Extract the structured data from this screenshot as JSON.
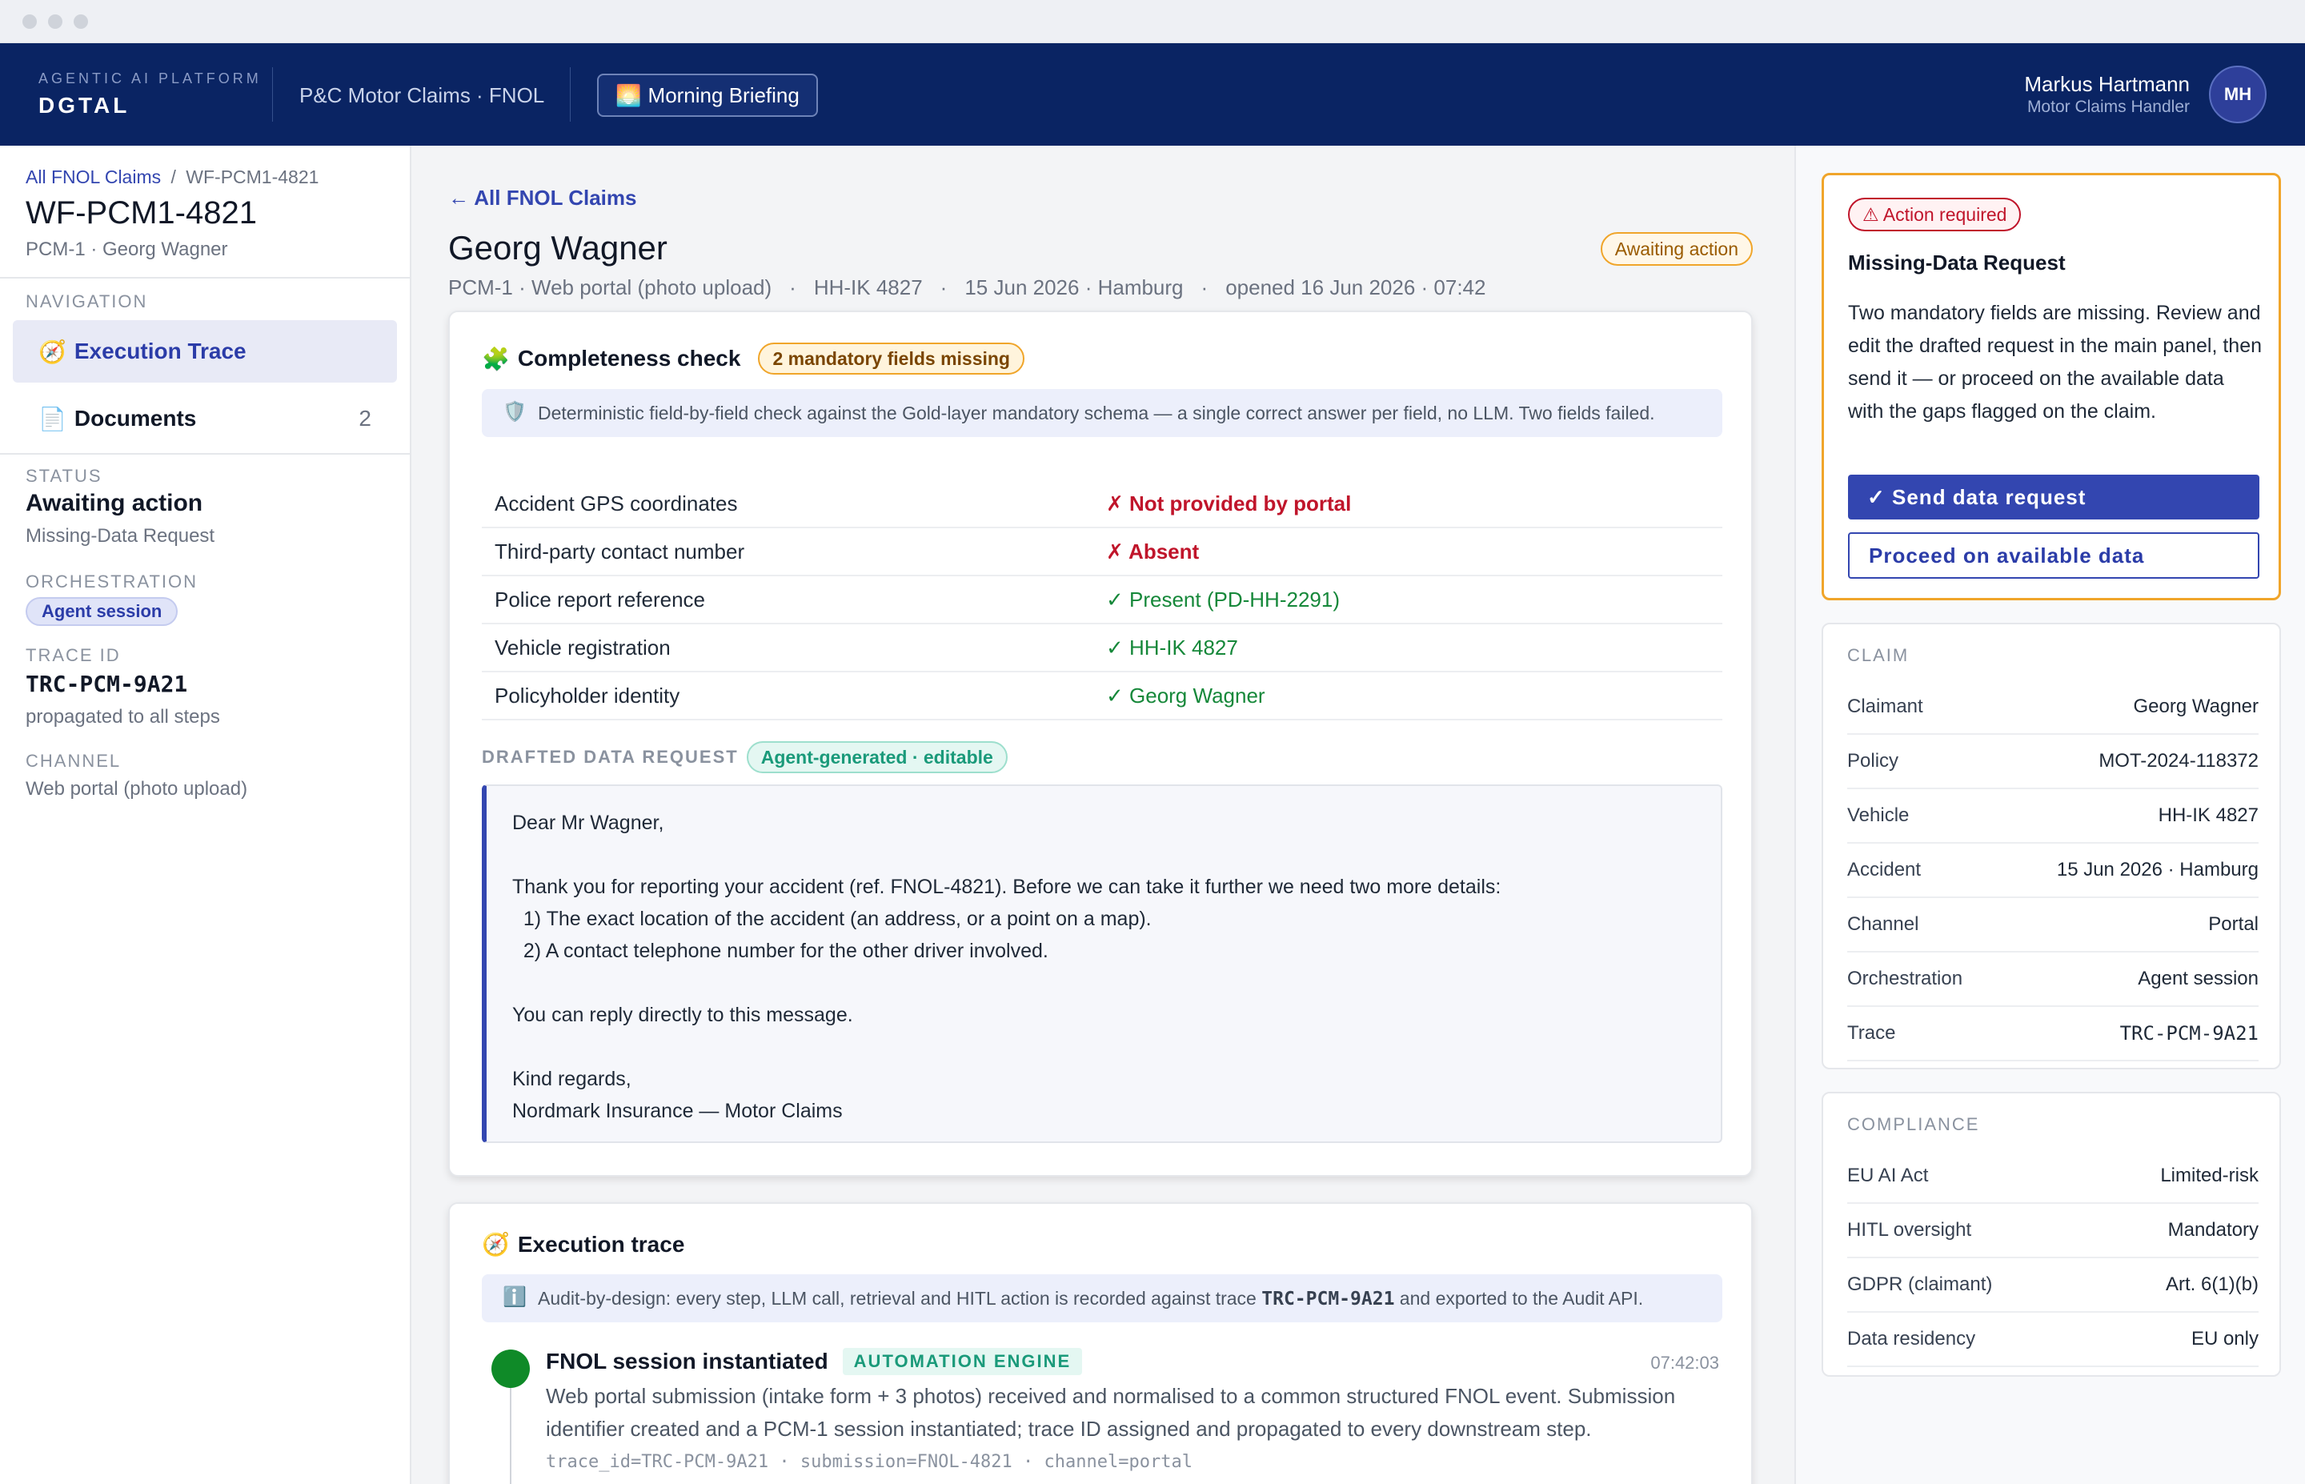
{
  "header": {
    "platform_label": "AGENTIC AI PLATFORM",
    "brand": "DGTAL",
    "product": "P&C Motor Claims · FNOL",
    "briefing_icon": "🌅",
    "briefing_label": "Morning Briefing",
    "user_name": "Markus Hartmann",
    "user_role": "Motor Claims Handler",
    "user_initials": "MH"
  },
  "sidebar": {
    "breadcrumb_root": "All FNOL Claims",
    "breadcrumb_sep": "/",
    "breadcrumb_current": "WF-PCM1-4821",
    "workflow_id": "WF-PCM1-4821",
    "workflow_sub": "PCM-1 · Georg Wagner",
    "nav_label": "NAVIGATION",
    "nav": [
      {
        "icon": "🧭",
        "label": "Execution Trace"
      },
      {
        "icon": "📄",
        "label": "Documents",
        "count": "2"
      }
    ],
    "status_label": "STATUS",
    "status_value": "Awaiting action",
    "status_sub": "Missing-Data Request",
    "orchestration_label": "ORCHESTRATION",
    "orchestration_value": "Agent session",
    "trace_label": "TRACE ID",
    "trace_value": "TRC-PCM-9A21",
    "trace_sub": "propagated to all steps",
    "channel_label": "CHANNEL",
    "channel_value": "Web portal (photo upload)"
  },
  "main": {
    "back_label": "← All FNOL Claims",
    "claimant": "Georg Wagner",
    "meta": [
      "PCM-1 · Web portal (photo upload)",
      "HH-IK 4827",
      "15 Jun 2026 · Hamburg",
      "opened 16 Jun 2026 · 07:42"
    ],
    "meta_sep": "·",
    "status_pill": "Awaiting action",
    "completeness": {
      "icon": "🧩",
      "title": "Completeness check",
      "badge": "2 mandatory fields missing",
      "info_icon": "🛡️",
      "info": "Deterministic field-by-field check against the Gold-layer mandatory schema — a single correct answer per field, no LLM. Two fields failed.",
      "fields": [
        {
          "label": "Accident GPS coordinates",
          "value": "✗ Not provided by portal",
          "status": "bad"
        },
        {
          "label": "Third-party contact number",
          "value": "✗ Absent",
          "status": "bad"
        },
        {
          "label": "Police report reference",
          "value": "✓ Present (PD-HH-2291)",
          "status": "ok"
        },
        {
          "label": "Vehicle registration",
          "value": "✓ HH-IK 4827",
          "status": "ok"
        },
        {
          "label": "Policyholder identity",
          "value": "✓ Georg Wagner",
          "status": "ok"
        }
      ],
      "drafted_label": "DRAFTED DATA REQUEST",
      "drafted_badge": "Agent-generated · editable",
      "letter": "Dear Mr Wagner,\n\nThank you for reporting your accident (ref. FNOL-4821). Before we can take it further we need two more details:\n  1) The exact location of the accident (an address, or a point on a map).\n  2) A contact telephone number for the other driver involved.\n\nYou can reply directly to this message.\n\nKind regards,\nNordmark Insurance — Motor Claims"
    },
    "trace": {
      "icon": "🧭",
      "title": "Execution trace",
      "info_icon": "ℹ️",
      "info_prefix": "Audit-by-design: every step, LLM call, retrieval and HITL action is recorded against trace ",
      "info_trace": "TRC-PCM-9A21",
      "info_suffix": " and exported to the Audit API.",
      "step": {
        "title": "FNOL session instantiated",
        "badge": "AUTOMATION ENGINE",
        "time": "07:42:03",
        "desc": "Web portal submission (intake form + 3 photos) received and normalised to a common structured FNOL event. Submission identifier created and a PCM-1 session instantiated; trace ID assigned and propagated to every downstream step.",
        "meta": "trace_id=TRC-PCM-9A21 · submission=FNOL-4821 · channel=portal"
      }
    }
  },
  "right": {
    "action_pill": "⚠ Action required",
    "action_title": "Missing-Data Request",
    "action_text": "Two mandatory fields are missing. Review and edit the drafted request in the main panel, then send it — or proceed on the available data with the gaps flagged on the claim.",
    "primary_btn": "✓ Send data request",
    "secondary_btn": "Proceed on available data",
    "claim_label": "CLAIM",
    "claim_rows": [
      {
        "k": "Claimant",
        "v": "Georg Wagner"
      },
      {
        "k": "Policy",
        "v": "MOT-2024-118372"
      },
      {
        "k": "Vehicle",
        "v": "HH-IK 4827"
      },
      {
        "k": "Accident",
        "v": "15 Jun 2026 · Hamburg"
      },
      {
        "k": "Channel",
        "v": "Portal"
      },
      {
        "k": "Orchestration",
        "v": "Agent session"
      },
      {
        "k": "Trace",
        "v": "TRC-PCM-9A21"
      }
    ],
    "compliance_label": "COMPLIANCE",
    "compliance_rows": [
      {
        "k": "EU AI Act",
        "v": "Limited-risk"
      },
      {
        "k": "HITL oversight",
        "v": "Mandatory"
      },
      {
        "k": "GDPR (claimant)",
        "v": "Art. 6(1)(b)"
      },
      {
        "k": "Data residency",
        "v": "EU only"
      }
    ]
  }
}
